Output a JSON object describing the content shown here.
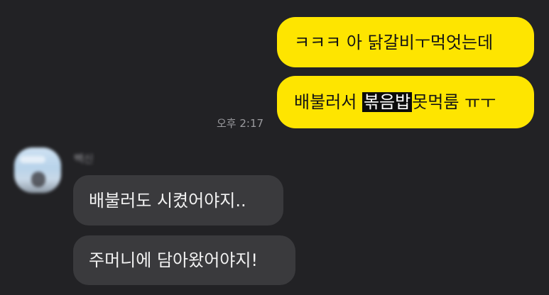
{
  "chat": {
    "sent": [
      {
        "text": "ㅋㅋㅋ 아 닭갈비ㅜ먹엇는데"
      },
      {
        "before": "배불러서 ",
        "highlight": "볶음밥",
        "after": "못먹룸 ㅠㅜ"
      }
    ],
    "sent_time": "오후 2:17",
    "sender_name": "빽신",
    "received": [
      {
        "text": "배불러도 시켰어야지.."
      },
      {
        "text": "주머니에 담아왔어야지!"
      }
    ]
  },
  "colors": {
    "background": "#222225",
    "sent_bubble": "#fee500",
    "received_bubble": "#3a3a3d"
  }
}
